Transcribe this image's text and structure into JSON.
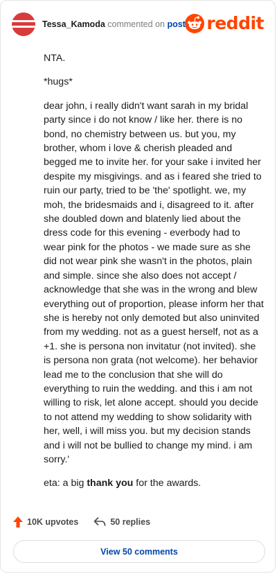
{
  "header": {
    "username": "Tessa_Kamoda",
    "action_text": "commented on",
    "link_text": "post",
    "brand": "reddit"
  },
  "comment": {
    "p1": "NTA.",
    "p2": "*hugs*",
    "p3": "dear john, i really didn't want sarah in my bridal party since i do not know / like her. there is no bond, no chemistry between us. but you, my brother, whom i love & cherish pleaded and begged me to invite her. for your sake i invited her despite my misgivings. and as i feared she tried to ruin our party, tried to be 'the' spotlight. we, my moh, the bridesmaids and i, disagreed to it. after she doubled down and blatenly lied about the dress code for this evening - everbody had to wear pink for the photos - we made sure as she did not wear pink she wasn't in the photos, plain and simple. since she also does not accept / acknowledge that she was in the wrong and blew everything out of proportion, please inform her that she is hereby not only demoted but also uninvited from my wedding. not as a guest herself, not as a +1. she is persona non invitatur (not invited). she is persona non grata (not welcome). her behavior lead me to the conclusion that she will do everything to ruin the wedding. and this i am not willing to risk, let alone accept. should you decide to not attend my wedding to show solidarity with her, well, i will miss you. but my decision stands and i will not be bullied to change my mind. i am sorry.'",
    "p4_before": "eta: a big ",
    "p4_bold": "thank you",
    "p4_after": " for the awards."
  },
  "footer": {
    "upvotes": "10K upvotes",
    "replies": "50 replies",
    "view_comments": "View 50 comments"
  },
  "colors": {
    "brand": "#ff4500",
    "link": "#0045ac",
    "avatar": "#d93a3a"
  }
}
